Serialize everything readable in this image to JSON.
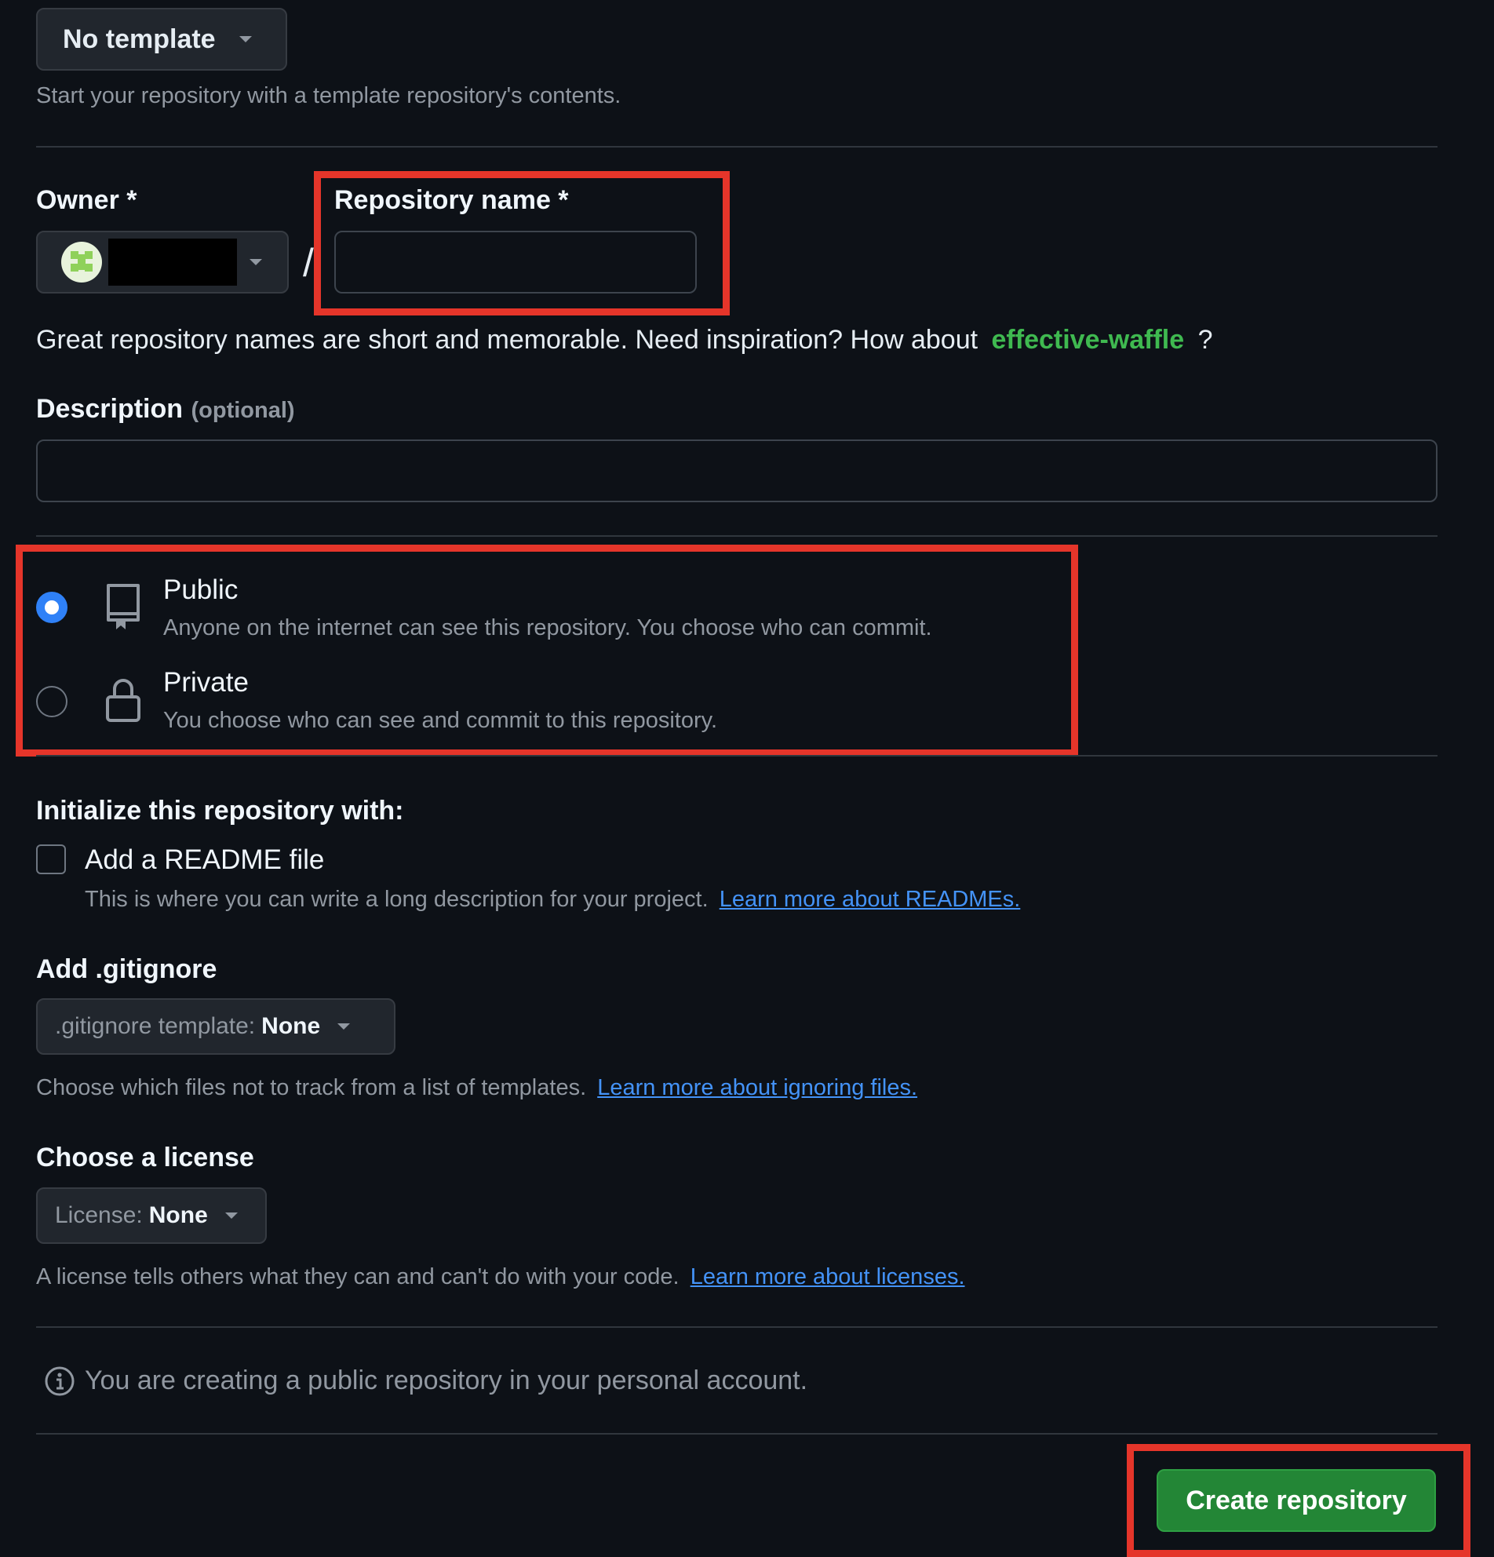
{
  "template": {
    "button_label": "No template",
    "help": "Start your repository with a template repository's contents."
  },
  "owner": {
    "label": "Owner *"
  },
  "separator": "/",
  "repo_name": {
    "label": "Repository name *",
    "value": "",
    "hint_prefix": "Great repository names are short and memorable. Need inspiration? How about",
    "suggestion": "effective-waffle",
    "hint_suffix": "?"
  },
  "description": {
    "label": "Description",
    "optional": "(optional)",
    "value": ""
  },
  "visibility": {
    "options": [
      {
        "title": "Public",
        "desc": "Anyone on the internet can see this repository. You choose who can commit.",
        "selected": true,
        "icon": "repo-icon"
      },
      {
        "title": "Private",
        "desc": "You choose who can see and commit to this repository.",
        "selected": false,
        "icon": "lock-icon"
      }
    ]
  },
  "init": {
    "heading": "Initialize this repository with:",
    "readme_label": "Add a README file",
    "readme_checked": false,
    "readme_desc": "This is where you can write a long description for your project.",
    "readme_link": "Learn more about READMEs."
  },
  "gitignore": {
    "heading": "Add .gitignore",
    "select_prefix": ".gitignore template:",
    "select_value": "None",
    "desc": "Choose which files not to track from a list of templates.",
    "link": "Learn more about ignoring files."
  },
  "license": {
    "heading": "Choose a license",
    "select_prefix": "License:",
    "select_value": "None",
    "desc": "A license tells others what they can and can't do with your code.",
    "link": "Learn more about licenses."
  },
  "notice": {
    "text": "You are creating a public repository in your personal account.",
    "icon": "info-icon"
  },
  "submit": {
    "label": "Create repository"
  },
  "colors": {
    "background": "#0d1117",
    "accent_green": "#238636",
    "suggestion_green": "#3fb950",
    "link_blue": "#4493f8",
    "highlight_red": "#e5352a",
    "radio_blue": "#2f81f7"
  }
}
